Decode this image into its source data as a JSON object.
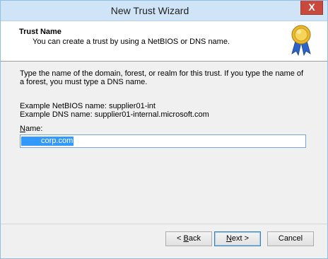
{
  "window": {
    "title": "New Trust Wizard",
    "close_glyph": "X"
  },
  "header": {
    "title": "Trust Name",
    "subtitle": "You can create a trust by using a NetBIOS or DNS name.",
    "icon": "certificate-ribbon-icon"
  },
  "content": {
    "description": "Type the name of the domain, forest, or realm for this trust. If you type the name of a forest, you must type a DNS name.",
    "example_netbios": "Example NetBIOS name: supplier01-int",
    "example_dns": "Example DNS name: supplier01-internal.microsoft.com",
    "name_label_underlined": "N",
    "name_label_rest": "ame:",
    "name_value": "corp.com"
  },
  "buttons": {
    "back_prefix": "< ",
    "back_underlined": "B",
    "back_rest": "ack",
    "next_underlined": "N",
    "next_rest": "ext >",
    "cancel": "Cancel"
  },
  "colors": {
    "selection": "#3399ff",
    "titlebar": "#cfe4f6",
    "close": "#c94a3c"
  }
}
